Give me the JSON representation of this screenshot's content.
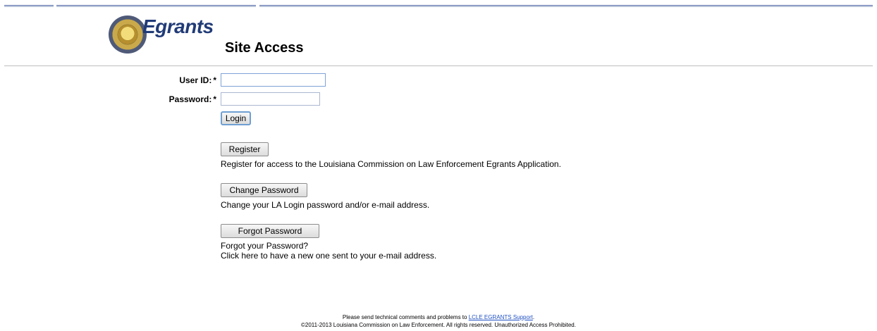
{
  "header": {
    "brand": "Egrants",
    "page_title": "Site Access"
  },
  "form": {
    "user_id_label": "User ID:",
    "password_label": "Password:",
    "required_mark": "*",
    "user_id_value": "",
    "password_value": "",
    "login_label": "Login"
  },
  "actions": {
    "register_label": "Register",
    "register_desc": "Register for access to the Louisiana Commission on Law Enforcement Egrants Application.",
    "change_label": "Change Password",
    "change_desc": "Change your LA Login password and/or e-mail address.",
    "forgot_label": "Forgot Password",
    "forgot_desc_1": "Forgot your Password?",
    "forgot_desc_2": "Click here to have a new one sent to your e-mail address."
  },
  "footer": {
    "line1_prefix": "Please send technical comments and problems to ",
    "support_link": "LCLE EGRANTS Support",
    "line1_suffix": ".",
    "line2": "©2011-2013 Louisiana Commission on Law Enforcement. All rights reserved. Unauthorized Access Prohibited."
  },
  "colors": {
    "brand_blue": "#213b77",
    "brand_gold": "#b88a22",
    "link": "#1e4fc2"
  },
  "icons": {
    "seal": "state-seal-icon"
  }
}
